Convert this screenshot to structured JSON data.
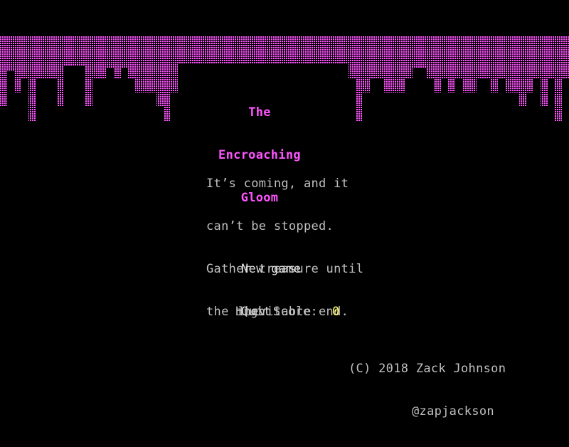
{
  "game": {
    "title_lines": [
      "The",
      "Encroaching",
      "Gloom"
    ],
    "intro_lines": [
      "It’s coming, and it",
      "can’t be stopped.",
      "Gather treasure until",
      "the inevitable end."
    ],
    "menu": [
      {
        "label": "New game"
      },
      {
        "label": "Quit"
      }
    ],
    "high_score_label": "High Score:",
    "high_score_value": "0",
    "credit_line_1": "(C) 2018 Zack Johnson",
    "credit_line_2": "@zapjackson"
  },
  "colors": {
    "background": "#000000",
    "gloom": "#ff55ff",
    "title": "#ff55ff",
    "text": "#c0c0c0",
    "menu_text": "#e0e0e0",
    "score_value": "#ffff55"
  }
}
